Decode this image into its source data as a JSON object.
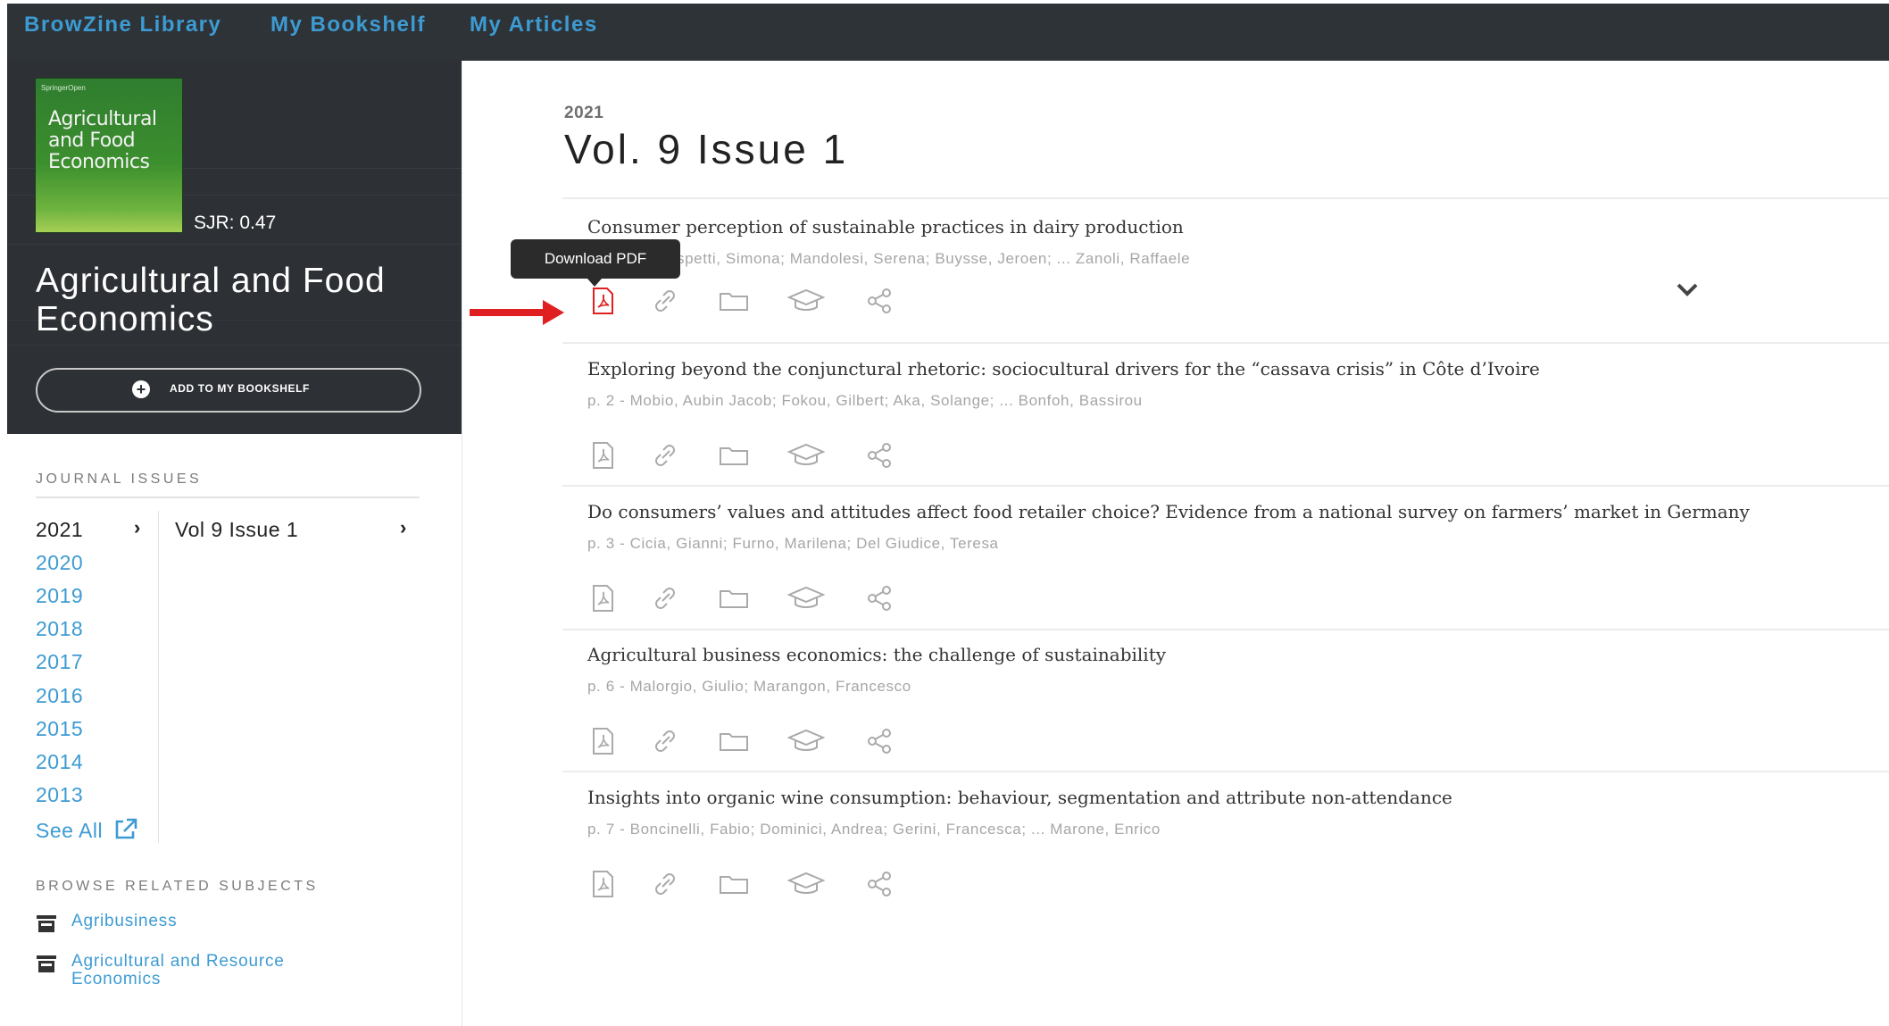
{
  "nav": {
    "items": [
      {
        "label": "BrowZine Library"
      },
      {
        "label": "My Bookshelf"
      },
      {
        "label": "My Articles"
      }
    ]
  },
  "journal": {
    "cover_text": "Agricultural and Food Economics",
    "cover_publisher": "SpringerOpen",
    "sjr": "SJR: 0.47",
    "title": "Agricultural and Food Economics",
    "add_button": "ADD TO MY BOOKSHELF"
  },
  "sidebar": {
    "issues_heading": "JOURNAL ISSUES",
    "years": [
      "2021",
      "2020",
      "2019",
      "2018",
      "2017",
      "2016",
      "2015",
      "2014",
      "2013"
    ],
    "selected_year": "2021",
    "see_all": "See All",
    "selected_issue": "Vol 9 Issue 1",
    "subjects_heading": "BROWSE RELATED SUBJECTS",
    "subjects": [
      "Agribusiness",
      "Agricultural and Resource Economics"
    ]
  },
  "issue": {
    "year": "2021",
    "title": "Vol. 9 Issue 1"
  },
  "tooltip": "Download PDF",
  "articles": [
    {
      "title": "Consumer perception of sustainable practices in dairy production",
      "meta": "spetti, Simona; Mandolesi, Serena; Buysse, Jeroen; ... Zanoli, Raffaele"
    },
    {
      "title": "Exploring beyond the conjunctural rhetoric: sociocultural drivers for the “cassava crisis” in Côte d’Ivoire",
      "meta": "p. 2  -  Mobio, Aubin Jacob; Fokou, Gilbert; Aka, Solange; ... Bonfoh, Bassirou"
    },
    {
      "title": "Do consumers’ values and attitudes affect food retailer choice? Evidence from a national survey on farmers’ market in Germany",
      "meta": "p. 3  -  Cicia, Gianni; Furno, Marilena; Del Giudice, Teresa"
    },
    {
      "title": "Agricultural business economics: the challenge of sustainability",
      "meta": "p. 6  -  Malorgio, Giulio; Marangon, Francesco"
    },
    {
      "title": "Insights into organic wine consumption: behaviour, segmentation and attribute non-attendance",
      "meta": "p. 7  -  Boncinelli, Fabio; Dominici, Andrea; Gerini, Francesca; ... Marone, Enrico"
    }
  ],
  "colors": {
    "nav_bg": "#2e3338",
    "accent": "#3d9bd3",
    "highlight_red": "#e02020"
  },
  "icons": [
    "pdf-icon",
    "link-icon",
    "folder-icon",
    "cite-icon",
    "share-icon",
    "chevron-down-icon",
    "external-link-icon",
    "library-icon"
  ]
}
